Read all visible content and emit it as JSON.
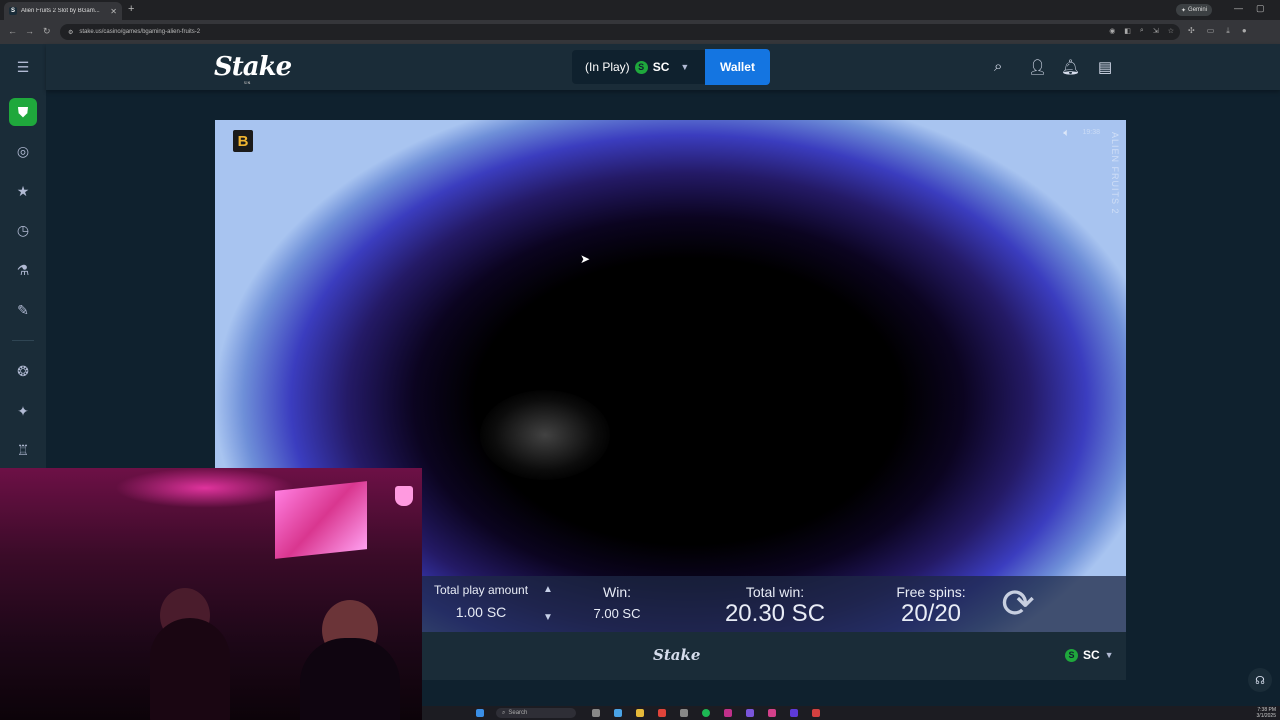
{
  "browser": {
    "tab_title": "Alien Fruits 2 Slot by BGam...",
    "tab_favicon": "S",
    "url": "stake.us/casino/games/bgaming-alien-fruits-2",
    "gemini_label": "Gemini"
  },
  "header": {
    "logo": "Stake",
    "logo_sub": "US",
    "balance_label": "(In Play)",
    "currency_icon": "S",
    "currency": "SC",
    "wallet_label": "Wallet"
  },
  "game": {
    "provider_badge": "B",
    "title": "ALIEN FRUITS 2",
    "clock": "19:38",
    "total_play_label": "Total play amount",
    "total_play_value": "1.00 SC",
    "win_label": "Win:",
    "win_value": "7.00 SC",
    "total_win_label": "Total win:",
    "total_win_value": "20.30 SC",
    "free_spins_label": "Free spins:",
    "free_spins_value": "20/20"
  },
  "footer": {
    "logo": "Stake",
    "currency_icon": "S",
    "currency": "SC"
  },
  "taskbar": {
    "search_placeholder": "Search",
    "time": "7:38 PM",
    "date": "3/1/2025"
  },
  "colors": {
    "stake_bg": "#0f212e",
    "stake_panel": "#1a2c38",
    "wallet_blue": "#1475e1",
    "sc_green": "#1fa83c"
  }
}
